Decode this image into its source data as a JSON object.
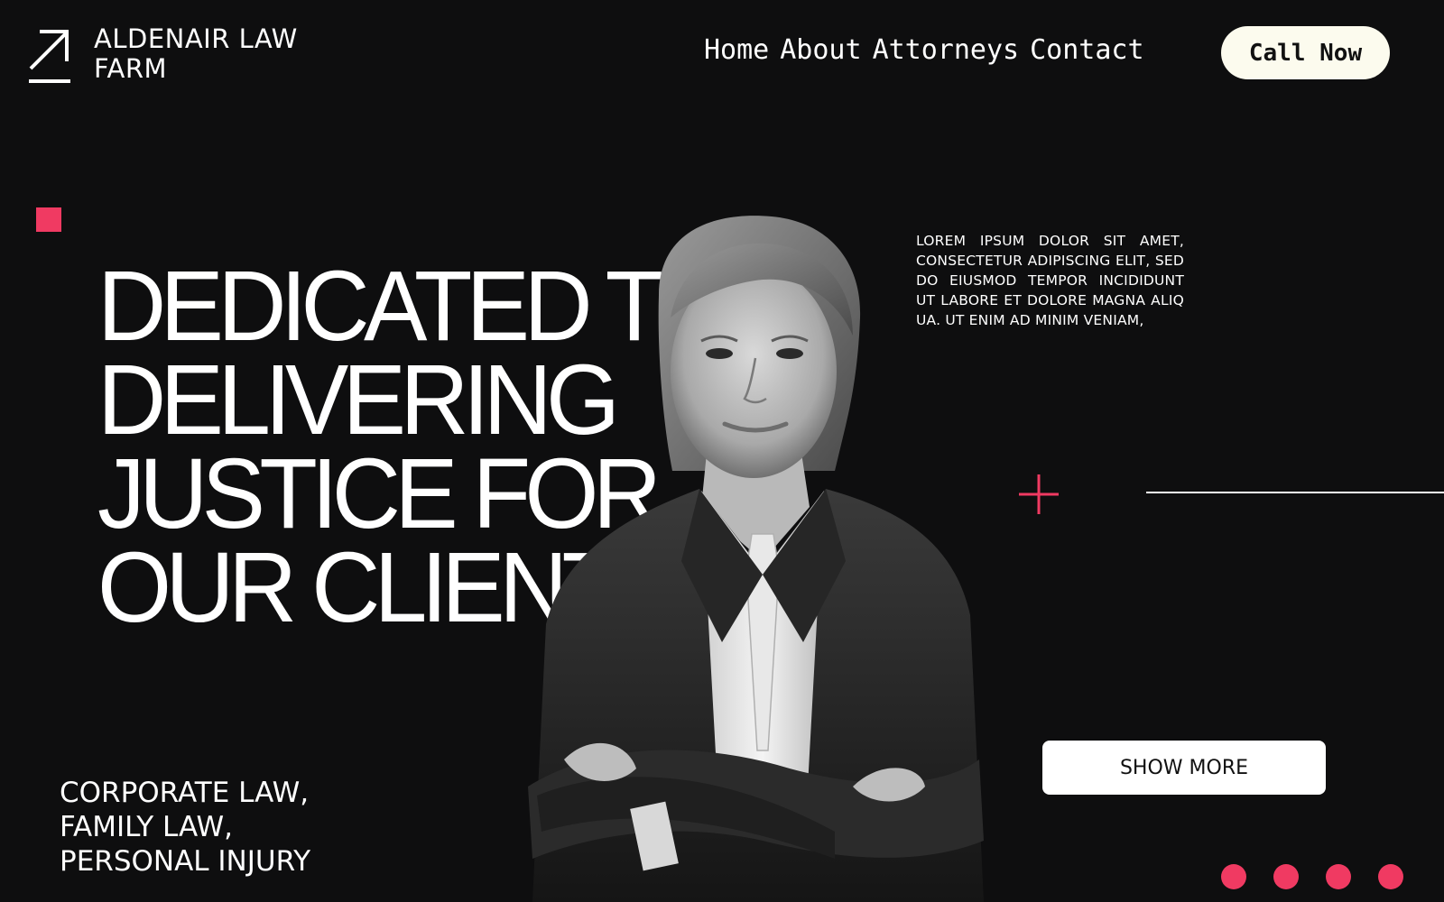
{
  "brand": {
    "name_line1": "ALDENAIR LAW",
    "name_line2": "FARM",
    "logo_icon": "arrow-up-right-icon"
  },
  "nav": {
    "items": [
      {
        "label": "Home"
      },
      {
        "label": "About"
      },
      {
        "label": "Attorneys"
      },
      {
        "label": "Contact"
      }
    ],
    "cta_label": "Call Now"
  },
  "hero": {
    "headline_lines": [
      "DEDICATED TO",
      "DELIVERING",
      "JUSTICE FOR",
      "OUR CLIENTS"
    ],
    "description": "LOREM IPSUM DOLOR SIT AMET, CONSECTETUR ADIPISCING ELIT, SED DO EIUSMOD TEMPOR INCIDIDUNT UT LABORE ET DOLORE MAGNA ALIQ UA. UT ENIM AD MINIM VENIAM,",
    "show_more_label": "SHOW MORE",
    "practice_areas": [
      "CORPORATE LAW,",
      "FAMILY LAW,",
      "PERSONAL INJURY"
    ]
  },
  "carousel": {
    "dot_count": 4
  },
  "colors": {
    "background": "#0e0e0f",
    "accent": "#f03a62",
    "cta_background": "#fcfbee",
    "text": "#ffffff"
  },
  "icons": {
    "decor_square": "pink-square-icon",
    "decor_plus": "plus-icon"
  }
}
